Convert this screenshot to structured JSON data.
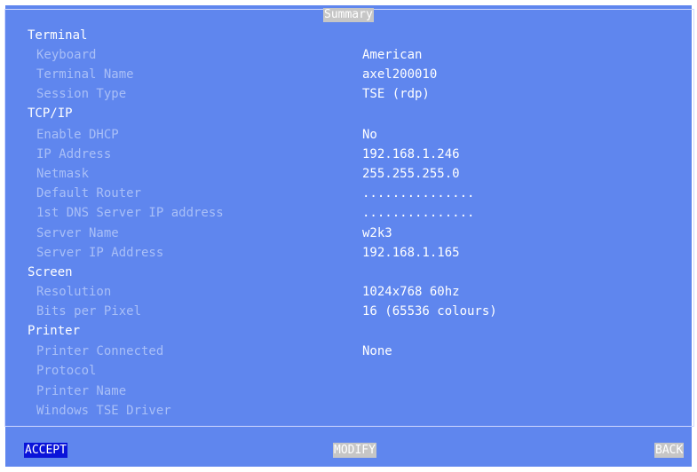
{
  "window": {
    "title": "Summary"
  },
  "sections": {
    "terminal": {
      "heading": "Terminal",
      "rows": [
        {
          "label": "Keyboard",
          "value": "American"
        },
        {
          "label": "Terminal Name",
          "value": "axel200010"
        },
        {
          "label": "Session Type",
          "value": "TSE (rdp)"
        }
      ]
    },
    "tcpip": {
      "heading": "TCP/IP",
      "rows": [
        {
          "label": "Enable DHCP",
          "value": "No"
        },
        {
          "label": "IP Address",
          "value": "192.168.1.246"
        },
        {
          "label": "Netmask",
          "value": "255.255.255.0"
        },
        {
          "label": "Default Router",
          "value": "..............."
        },
        {
          "label": "1st DNS Server IP address",
          "value": "..............."
        },
        {
          "label": "Server Name",
          "value": "w2k3"
        },
        {
          "label": "Server IP Address",
          "value": "192.168.1.165"
        }
      ]
    },
    "screen": {
      "heading": "Screen",
      "rows": [
        {
          "label": "Resolution",
          "value": "1024x768 60hz"
        },
        {
          "label": "Bits per Pixel",
          "value": "16 (65536 colours)"
        }
      ]
    },
    "printer": {
      "heading": "Printer",
      "rows": [
        {
          "label": "Printer Connected",
          "value": "None"
        },
        {
          "label": "Protocol",
          "value": ""
        },
        {
          "label": "Printer Name",
          "value": ""
        },
        {
          "label": "Windows TSE Driver",
          "value": ""
        }
      ]
    }
  },
  "buttons": {
    "accept": "ACCEPT",
    "modify": "MODIFY",
    "back": "BACK"
  },
  "colors": {
    "background": "#5f86ee",
    "label_text": "#a9bff7",
    "value_text": "#ffffff",
    "selected_button": "#0a14d9",
    "button_gray": "#c6c6c6"
  }
}
